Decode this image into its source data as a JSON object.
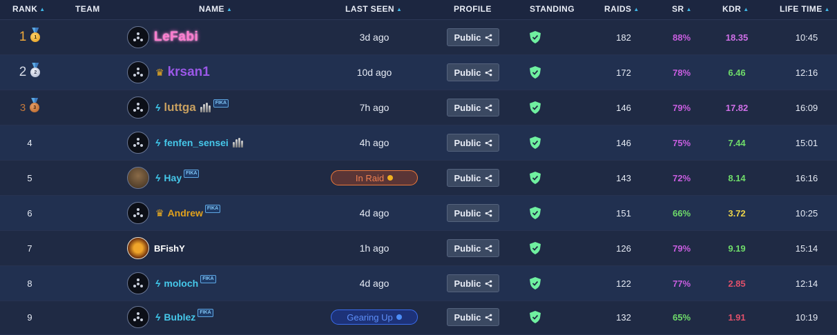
{
  "columns": {
    "rank": "RANK",
    "team": "TEAM",
    "name": "NAME",
    "last_seen": "LAST SEEN",
    "profile": "PROFILE",
    "standing": "STANDING",
    "raids": "RAIDS",
    "sr": "SR",
    "kdr": "KDR",
    "life_time": "LIFE TIME"
  },
  "sort_icons": [
    "rank",
    "name",
    "last_seen",
    "raids",
    "sr",
    "kdr",
    "life_time"
  ],
  "rows": [
    {
      "rank": "1",
      "medal": "1",
      "name": "LeFabi",
      "last_seen": "3d ago",
      "profile": "Public",
      "raids": "182",
      "sr": "88%",
      "kdr": "18.35",
      "life": "10:45"
    },
    {
      "rank": "2",
      "medal": "2",
      "name": "krsan1",
      "last_seen": "10d ago",
      "profile": "Public",
      "raids": "172",
      "sr": "78%",
      "kdr": "6.46",
      "life": "12:16"
    },
    {
      "rank": "3",
      "medal": "3",
      "name": "luttga",
      "tag": "FIKA",
      "last_seen": "7h ago",
      "profile": "Public",
      "raids": "146",
      "sr": "79%",
      "kdr": "17.82",
      "life": "16:09"
    },
    {
      "rank": "4",
      "name": "fenfen_sensei",
      "last_seen": "4h ago",
      "profile": "Public",
      "raids": "146",
      "sr": "75%",
      "kdr": "7.44",
      "life": "15:01"
    },
    {
      "rank": "5",
      "name": "Hay",
      "tag": "FIKA",
      "status": "In Raid",
      "profile": "Public",
      "raids": "143",
      "sr": "72%",
      "kdr": "8.14",
      "life": "16:16"
    },
    {
      "rank": "6",
      "name": "Andrew",
      "tag": "FIKA",
      "last_seen": "4d ago",
      "profile": "Public",
      "raids": "151",
      "sr": "66%",
      "kdr": "3.72",
      "life": "10:25"
    },
    {
      "rank": "7",
      "name": "BFishY",
      "last_seen": "1h ago",
      "profile": "Public",
      "raids": "126",
      "sr": "79%",
      "kdr": "9.19",
      "life": "15:14"
    },
    {
      "rank": "8",
      "name": "moloch",
      "tag": "FIKA",
      "last_seen": "4d ago",
      "profile": "Public",
      "raids": "122",
      "sr": "77%",
      "kdr": "2.85",
      "life": "12:14"
    },
    {
      "rank": "9",
      "name": "Bublez",
      "tag": "FIKA",
      "status": "Gearing Up",
      "profile": "Public",
      "raids": "132",
      "sr": "65%",
      "kdr": "1.91",
      "life": "10:19"
    }
  ],
  "colors": {
    "background": "#1f2a44",
    "sort_arrow": "#3fb6e6",
    "standing_shield": "#6ff0a0",
    "sr_high": "#c95ee0",
    "sr_normal": "#6fdc6a",
    "kdr_high": "#d070e8",
    "kdr_good": "#6fdc6a",
    "kdr_mid": "#ecd44a",
    "kdr_low": "#e0506a",
    "in_raid": "#f08050",
    "gearing_up": "#5d8ef8"
  },
  "icons": {
    "standing": "shield-icon",
    "share": "share-icon",
    "crown": "crown-icon",
    "bolt": "bolt-icon",
    "ammo": "ammo-icon",
    "medal": "medal-icon"
  }
}
